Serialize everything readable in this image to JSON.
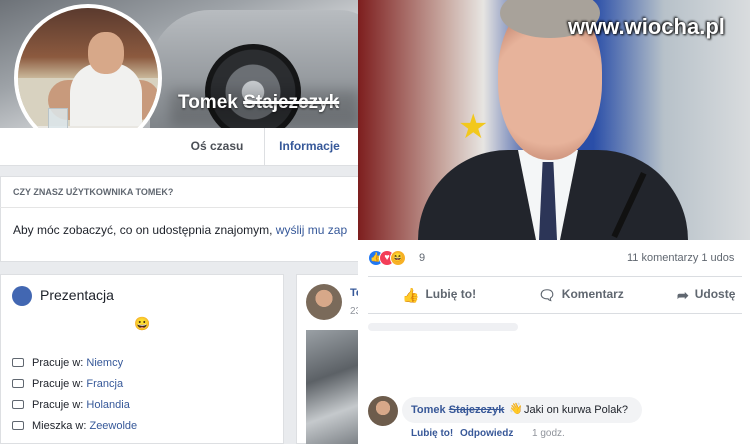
{
  "watermark": "www.wiocha.pl",
  "profile": {
    "first_name": "Tomek",
    "last_name_struck": "Stajezczyk"
  },
  "tabs": [
    {
      "label": "Oś czasu"
    },
    {
      "label": "Informacje"
    }
  ],
  "know_card": {
    "title": "CZY ZNASZ UŻYTKOWNIKA TOMEK?",
    "text": "Aby móc zobaczyć, co on udostępnia znajomym, ",
    "link": "wyślij mu zap"
  },
  "intro": {
    "title": "Prezentacja",
    "emoji": "😀",
    "rows": [
      {
        "prefix": "Pracuje w: ",
        "value": "Niemcy"
      },
      {
        "prefix": "Pracuje w: ",
        "value": "Francja"
      },
      {
        "prefix": "Pracuje w: ",
        "value": "Holandia"
      },
      {
        "prefix": "Mieszka w: ",
        "value": "Zeewolde"
      }
    ]
  },
  "post": {
    "author": "To",
    "date": "23"
  },
  "overlay_post": {
    "reaction_count": "9",
    "comments_count": "11 komentarzy  1 udos",
    "actions": {
      "like": "Lubię to!",
      "comment": "Komentarz",
      "share": "Udostę"
    }
  },
  "comment": {
    "author": "Tomek ",
    "author_struck": "Stajezczyk",
    "hand_icon": "👋",
    "text": "Jaki on kurwa Polak?",
    "like": "Lubię to!",
    "reply": "Odpowiedz",
    "time": "1 godz."
  },
  "colors": {
    "fb_blue": "#365899",
    "background": "#e9ebee"
  }
}
